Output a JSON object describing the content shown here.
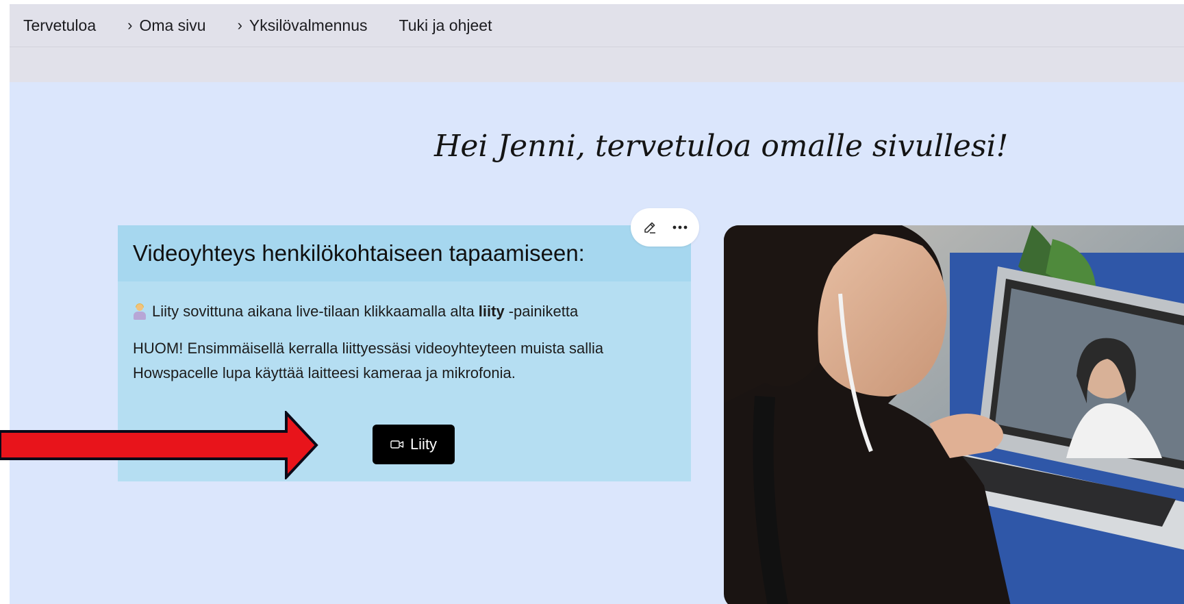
{
  "nav": {
    "items": [
      {
        "label": "Tervetuloa",
        "chevron": false
      },
      {
        "label": "Oma sivu",
        "chevron": true
      },
      {
        "label": "Yksilövalmennus",
        "chevron": true
      },
      {
        "label": "Tuki ja ohjeet",
        "chevron": false
      }
    ]
  },
  "greeting": "Hei Jenni, tervetuloa omalle sivullesi!",
  "card": {
    "title": "Videoyhteys henkilökohtaiseen tapaamiseen:",
    "instruction_before": "Liity sovittuna aikana live-tilaan klikkaamalla alta",
    "instruction_bold": "liity",
    "instruction_after": "-painiketta",
    "note": "HUOM! Ensimmäisellä kerralla liittyessäsi videoyhteyteen muista sallia Howspacelle lupa käyttää laitteesi kameraa ja mikrofonia.",
    "join_label": "Liity",
    "emoji_icon": "person-at-laptop-emoji"
  },
  "toolbar": {
    "icons": [
      "edit-icon",
      "more-icon"
    ]
  },
  "annotation": {
    "color": "#e8141b",
    "outline": "#0a0a18"
  }
}
